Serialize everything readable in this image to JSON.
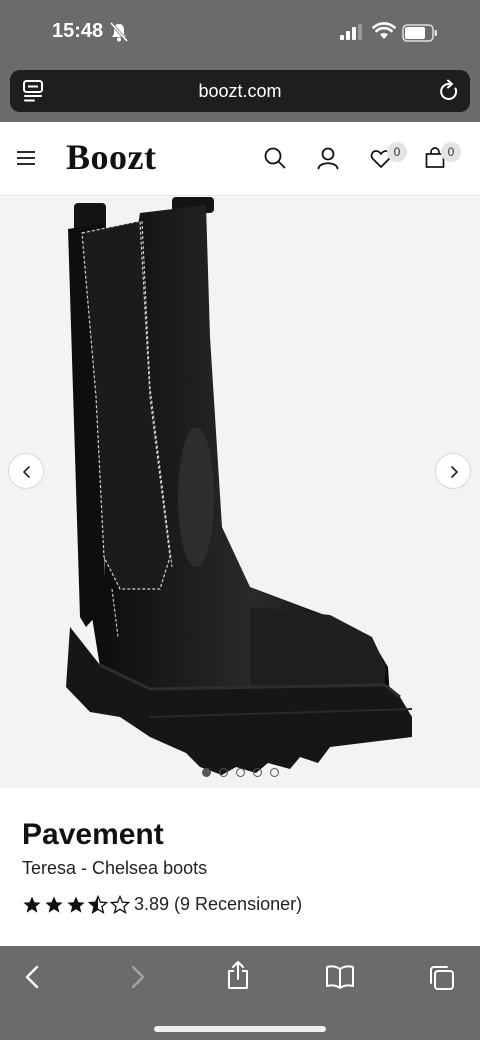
{
  "status_bar": {
    "time": "15:48",
    "icons": [
      "bell-slash-icon",
      "cellular-signal-icon",
      "wifi-icon",
      "battery-icon"
    ]
  },
  "browser": {
    "url": "boozt.com",
    "icons": [
      "tab-overview-icon",
      "reload-icon"
    ]
  },
  "site_header": {
    "logo": "Boozt",
    "wishlist_count": "0",
    "cart_count": "0",
    "icons": [
      "menu-icon",
      "search-icon",
      "account-icon",
      "heart-icon",
      "shopping-bag-icon"
    ]
  },
  "gallery": {
    "image_count": 5,
    "active_index": 0,
    "icons": [
      "chevron-left-icon",
      "chevron-right-icon"
    ]
  },
  "product": {
    "brand": "Pavement",
    "name": "Teresa - Chelsea boots",
    "rating": 3.89,
    "rating_text": "3.89 (9 Recensioner)",
    "stars_filled": 3.5,
    "stars_total": 5
  },
  "toolbar": {
    "icons": [
      "back-icon",
      "forward-icon",
      "share-icon",
      "bookmarks-icon",
      "tabs-icon"
    ]
  }
}
